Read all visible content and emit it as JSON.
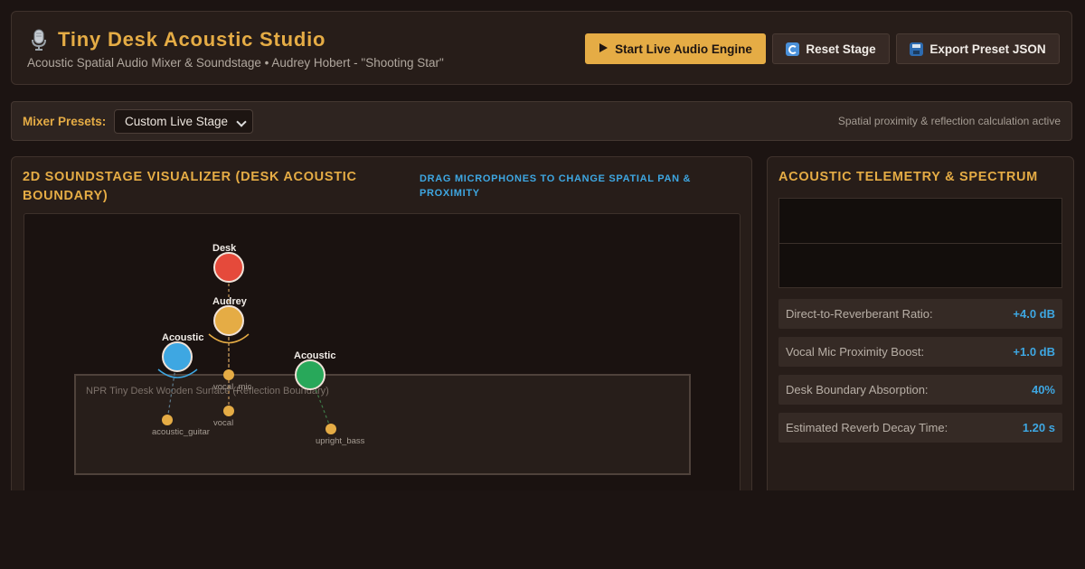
{
  "header": {
    "title": "Tiny Desk Acoustic Studio",
    "subtitle": "Acoustic Spatial Audio Mixer & Soundstage • Audrey Hobert - \"Shooting Star\"",
    "icon": "microphone-icon",
    "buttons": {
      "start": {
        "icon": "play-icon",
        "label": "Start Live Audio Engine"
      },
      "reset": {
        "icon": "reset-icon",
        "label": "Reset Stage"
      },
      "export": {
        "icon": "save-icon",
        "label": "Export Preset JSON"
      }
    }
  },
  "toolbar": {
    "presets_label": "Mixer Presets:",
    "preset_selected": "Custom Live Stage",
    "status": "Spatial proximity & reflection calculation active"
  },
  "soundstage": {
    "title": "2D Soundstage Visualizer (Desk Acoustic Boundary)",
    "hint": "Drag microphones to change spatial pan & proximity",
    "desk_label": "NPR Tiny Desk Wooden Surface (Reflection Boundary)",
    "mics": [
      {
        "name": "Desk",
        "color": "#e54a3b"
      },
      {
        "name": "Audrey",
        "color": "#e5ac45"
      },
      {
        "name": "Acoustic",
        "color": "#3ea7e2"
      },
      {
        "name": "Acoustic",
        "color": "#28a85a"
      }
    ],
    "sources": [
      "acoustic_guitar",
      "vocal",
      "vocal_mic",
      "upright_bass"
    ]
  },
  "telemetry": {
    "title": "Acoustic Telemetry & Spectrum",
    "metrics": [
      {
        "label": "Direct-to-Reverberant Ratio:",
        "value": "+4.0 dB"
      },
      {
        "label": "Vocal Mic Proximity Boost:",
        "value": "+1.0 dB"
      },
      {
        "label": "Desk Boundary Absorption:",
        "value": "40%"
      },
      {
        "label": "Estimated Reverb Decay Time:",
        "value": "1.20 s"
      }
    ]
  }
}
